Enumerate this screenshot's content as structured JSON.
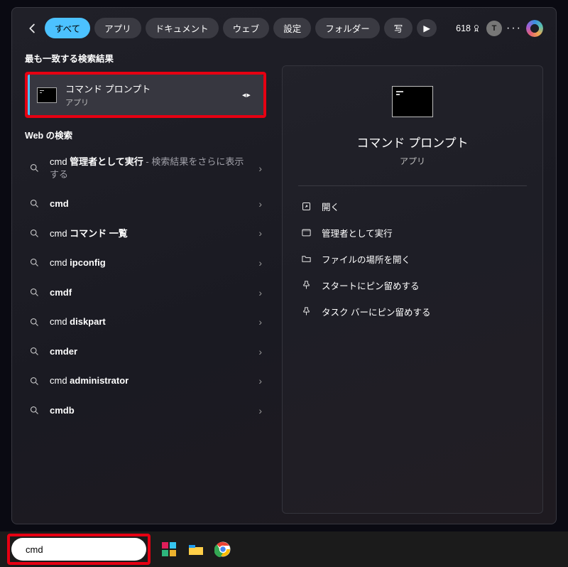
{
  "header": {
    "tabs": [
      {
        "label": "すべて",
        "active": true
      },
      {
        "label": "アプリ"
      },
      {
        "label": "ドキュメント"
      },
      {
        "label": "ウェブ"
      },
      {
        "label": "設定"
      },
      {
        "label": "フォルダー"
      },
      {
        "label": "写"
      }
    ],
    "points": "618",
    "avatar_initial": "T"
  },
  "left": {
    "best_match_heading": "最も一致する検索結果",
    "best_match": {
      "title": "コマンド プロンプト",
      "subtitle": "アプリ"
    },
    "web_heading": "Web の検索",
    "web_results": [
      {
        "prefix": "cmd ",
        "bold": "管理者として実行",
        "suffix": " - 検索結果をさらに表示する"
      },
      {
        "prefix": "",
        "bold": "cmd",
        "suffix": ""
      },
      {
        "prefix": "cmd ",
        "bold": "コマンド 一覧",
        "suffix": ""
      },
      {
        "prefix": "cmd ",
        "bold": "ipconfig",
        "suffix": ""
      },
      {
        "prefix": "",
        "bold": "cmdf",
        "suffix": ""
      },
      {
        "prefix": "cmd ",
        "bold": "diskpart",
        "suffix": ""
      },
      {
        "prefix": "",
        "bold": "cmder",
        "suffix": ""
      },
      {
        "prefix": "cmd ",
        "bold": "administrator",
        "suffix": ""
      },
      {
        "prefix": "",
        "bold": "cmdb",
        "suffix": ""
      }
    ]
  },
  "right": {
    "title": "コマンド プロンプト",
    "subtitle": "アプリ",
    "actions": [
      {
        "icon": "open",
        "label": "開く"
      },
      {
        "icon": "admin",
        "label": "管理者として実行"
      },
      {
        "icon": "folder",
        "label": "ファイルの場所を開く"
      },
      {
        "icon": "pin",
        "label": "スタートにピン留めする"
      },
      {
        "icon": "pin",
        "label": "タスク バーにピン留めする"
      }
    ]
  },
  "taskbar": {
    "search_value": "cmd"
  },
  "colors": {
    "accent": "#4cc2ff",
    "highlight": "#e60012"
  }
}
